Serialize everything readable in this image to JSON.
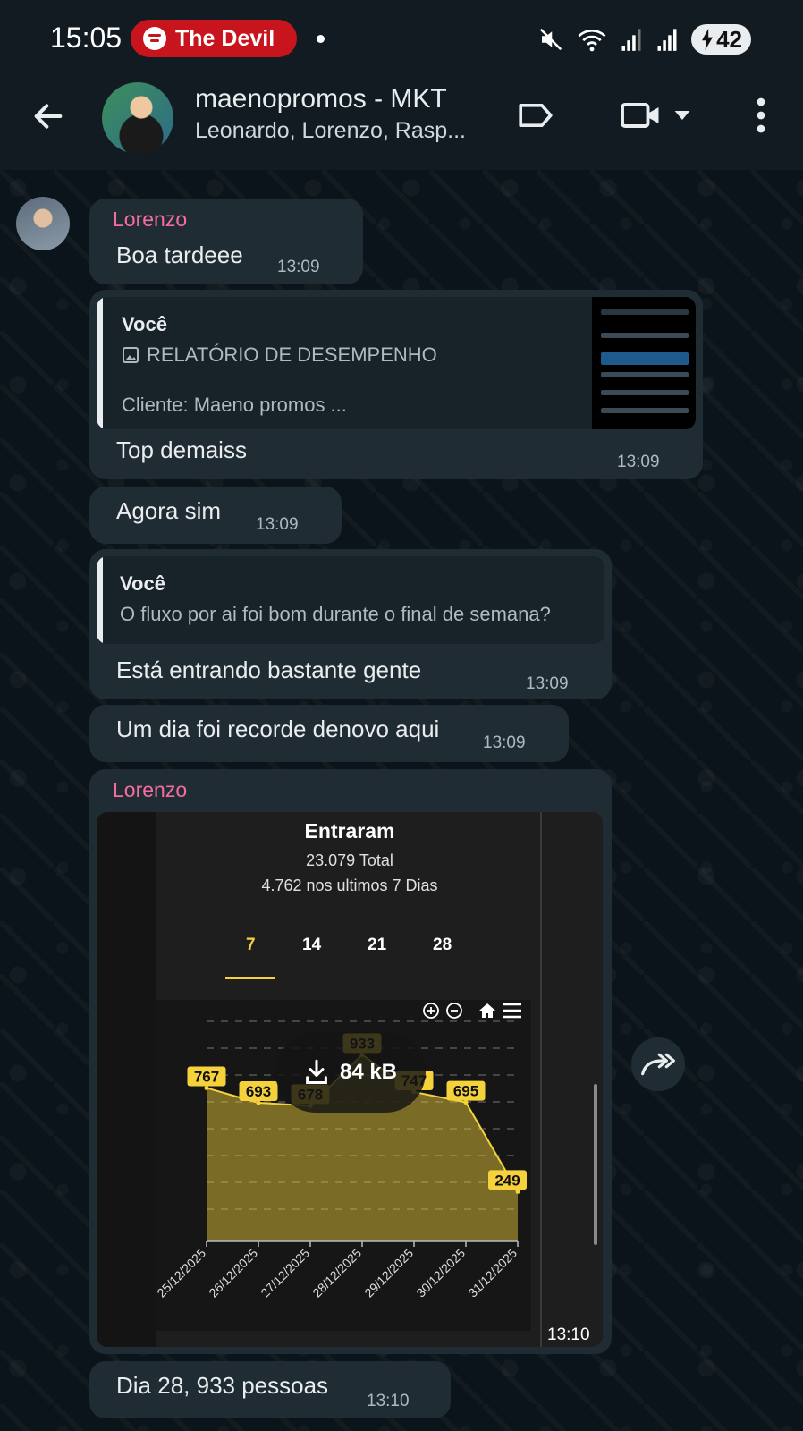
{
  "status_bar": {
    "time": "15:05",
    "now_playing": "The Devil",
    "battery": "42",
    "icons": [
      "spotify-icon",
      "mute-icon",
      "wifi-icon",
      "signal-icon",
      "signal-icon-2",
      "battery-charging-icon"
    ]
  },
  "header": {
    "title": "maenopromos - MKT",
    "subtitle": "Leonardo, Lorenzo, Rasp..."
  },
  "messages": [
    {
      "sender": "Lorenzo",
      "text": "Boa tardeee",
      "time": "13:09"
    },
    {
      "quote_author": "Você",
      "quote_title": "RELATÓRIO DE DESEMPENHO",
      "quote_text": "Cliente: Maeno promos ...",
      "text": "Top demaiss",
      "time": "13:09"
    },
    {
      "text": "Agora sim",
      "time": "13:09"
    },
    {
      "quote_author": "Você",
      "quote_text": "O fluxo por ai foi bom durante o final de semana?",
      "text": "Está entrando bastante gente",
      "time": "13:09"
    },
    {
      "text": "Um dia foi recorde denovo aqui",
      "time": "13:09"
    },
    {
      "sender": "Lorenzo",
      "time": "13:10",
      "download_size": "84 kB"
    },
    {
      "text": "Dia 28, 933 pessoas",
      "time": "13:10"
    }
  ],
  "chart_image": {
    "title": "Entraram",
    "total": "23.079 Total",
    "last7": "4.762 nos ultimos 7 Dias",
    "tabs": [
      "7",
      "14",
      "21",
      "28"
    ],
    "active_tab": "7"
  },
  "chart_data": {
    "type": "area",
    "title": "Entraram",
    "categories": [
      "25/12/2025",
      "26/12/2025",
      "27/12/2025",
      "28/12/2025",
      "29/12/2025",
      "30/12/2025",
      "31/12/2025"
    ],
    "values": [
      767,
      693,
      678,
      933,
      747,
      695,
      249
    ],
    "data_labels": [
      "767",
      "693",
      "678",
      "933",
      "747",
      "695",
      "249"
    ],
    "color": "#f5d23c",
    "ylim": [
      0,
      1100
    ],
    "grid": true
  },
  "colors": {
    "sender_name": "#f46ca0",
    "bubble": "#202c33",
    "background": "#0b141a",
    "chart_accent": "#f5d23c"
  }
}
